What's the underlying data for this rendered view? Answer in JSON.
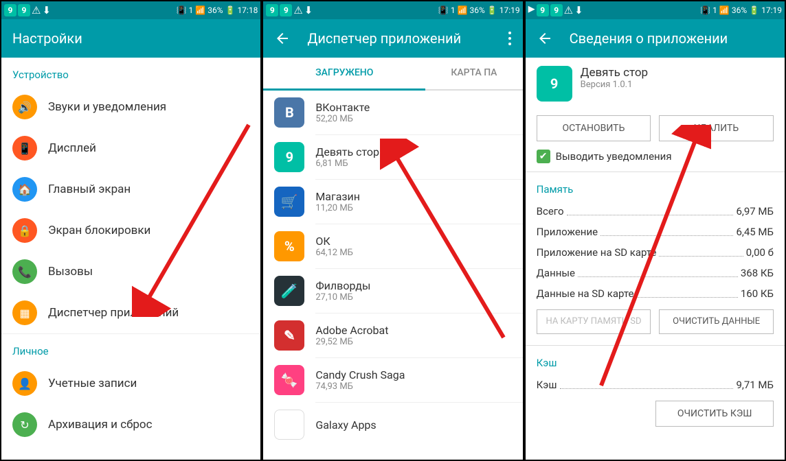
{
  "status": {
    "battery": "36%",
    "t1": "17:18",
    "t2": "17:19",
    "t3": "17:19",
    "sim": "1"
  },
  "panel1": {
    "title": "Настройки",
    "section_device": "Устройство",
    "items": {
      "sound": "Звуки и уведомления",
      "display": "Дисплей",
      "home": "Главный экран",
      "lock": "Экран блокировки",
      "calls": "Вызовы",
      "apps": "Диспетчер приложений"
    },
    "section_personal": "Личное",
    "accounts": "Учетные записи",
    "backup": "Архивация и сброс"
  },
  "panel2": {
    "title": "Диспетчер приложений",
    "tab_downloaded": "ЗАГРУЖЕНО",
    "tab_sd": "КАРТА ПА",
    "apps": {
      "vk": {
        "name": "ВКонтакте",
        "size": "52,20 МБ"
      },
      "nine": {
        "name": "Девять стор",
        "size": "6,81 МБ"
      },
      "shop": {
        "name": "Магазин",
        "size": "11,20 МБ"
      },
      "ok": {
        "name": "ОК",
        "size": "64,12 МБ"
      },
      "fil": {
        "name": "Филворды",
        "size": "27,10 МБ"
      },
      "adobe": {
        "name": "Adobe Acrobat",
        "size": "29,52 МБ"
      },
      "candy": {
        "name": "Candy Crush Saga",
        "size": "74,93 МБ"
      },
      "galaxy": {
        "name": "Galaxy Apps",
        "size": ""
      }
    }
  },
  "panel3": {
    "title": "Сведения о приложении",
    "app_name": "Девять стор",
    "app_version": "Версия 1.0.1",
    "btn_stop": "ОСТАНОВИТЬ",
    "btn_delete": "УДАЛИТЬ",
    "chk_notify": "Выводить уведомления",
    "section_memory": "Память",
    "rows": {
      "total": {
        "k": "Всего",
        "v": "6,97 МБ"
      },
      "app": {
        "k": "Приложение",
        "v": "6,45 МБ"
      },
      "appsd": {
        "k": "Приложение на SD карте",
        "v": "0,00 б"
      },
      "data": {
        "k": "Данные",
        "v": "368 КБ"
      },
      "datasd": {
        "k": "Данные на SD карте",
        "v": "160 КБ"
      }
    },
    "btn_sd": "НА КАРТУ ПАМЯТИ SD",
    "btn_clear": "ОЧИСТИТЬ ДАННЫЕ",
    "section_cache": "Кэш",
    "cache": {
      "k": "Кэш",
      "v": "9,71 МБ"
    },
    "btn_clear_cache": "ОЧИСТИТЬ КЭШ"
  }
}
